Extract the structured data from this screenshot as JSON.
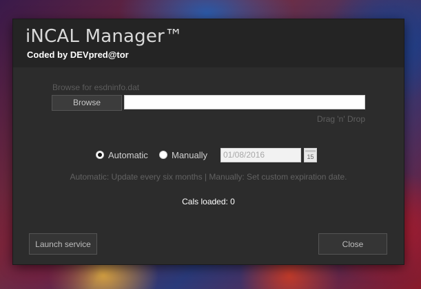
{
  "window": {
    "title": "iNCAL Manager™",
    "subtitle": "Coded by DEVpred@tor"
  },
  "browse": {
    "label": "Browse for esdninfo.dat",
    "button_label": "Browse",
    "path_value": "",
    "drag_hint": "Drag 'n' Drop"
  },
  "mode": {
    "automatic_label": "Automatic",
    "manual_label": "Manually",
    "selected": "automatic",
    "date_value": "01/08/2016",
    "calendar_day": "15",
    "calendar_icon": "calendar-icon",
    "hint": "Automatic: Update every six months | Manually: Set custom expiration date."
  },
  "status": {
    "cals_loaded": "Cals loaded: 0"
  },
  "actions": {
    "launch_label": "Launch service",
    "close_label": "Close"
  }
}
